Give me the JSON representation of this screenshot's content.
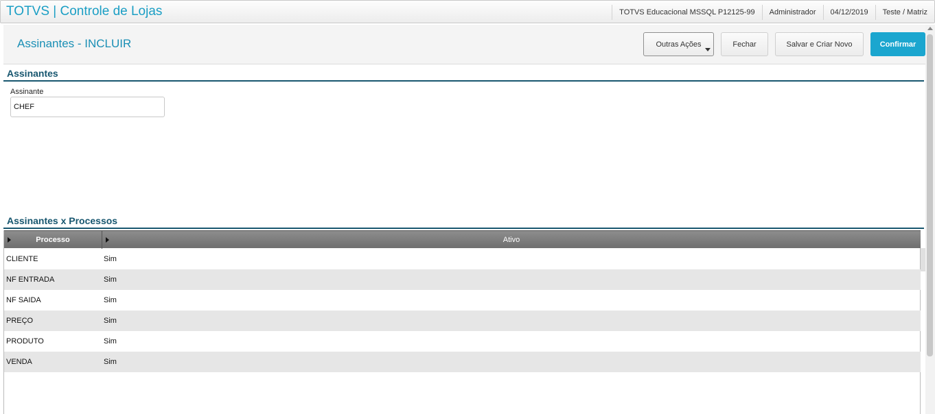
{
  "topbar": {
    "app_title": "TOTVS | Controle de Lojas",
    "environment": "TOTVS Educacional MSSQL P12125-99",
    "user": "Administrador",
    "date": "04/12/2019",
    "branch": "Teste / Matriz"
  },
  "header": {
    "page_title": "Assinantes - INCLUIR",
    "buttons": {
      "outras_acoes": "Outras Ações",
      "fechar": "Fechar",
      "salvar_criar_novo": "Salvar e Criar Novo",
      "confirmar": "Confirmar"
    }
  },
  "form": {
    "section_title": "Assinantes",
    "assinante_label": "Assinante",
    "assinante_value": "CHEF"
  },
  "grid": {
    "section_title": "Assinantes x Processos",
    "columns": [
      "Processo",
      "Ativo"
    ],
    "rows": [
      {
        "processo": "CLIENTE",
        "ativo": "Sim"
      },
      {
        "processo": "NF ENTRADA",
        "ativo": "Sim"
      },
      {
        "processo": "NF SAIDA",
        "ativo": "Sim"
      },
      {
        "processo": "PREÇO",
        "ativo": "Sim"
      },
      {
        "processo": "PRODUTO",
        "ativo": "Sim"
      },
      {
        "processo": "VENDA",
        "ativo": "Sim"
      }
    ]
  },
  "colors": {
    "accent": "#1ba6cf",
    "section": "#17566f"
  }
}
